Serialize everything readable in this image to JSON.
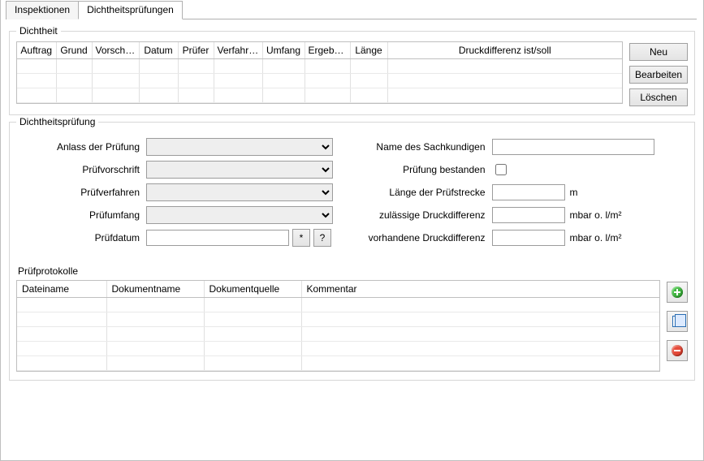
{
  "tabs": {
    "inspektionen": "Inspektionen",
    "dichtheit": "Dichtheitsprüfungen"
  },
  "dichtheit": {
    "legend": "Dichtheit",
    "columns": {
      "auftrag": "Auftrag",
      "grund": "Grund",
      "vorschrift": "Vorschrift",
      "datum": "Datum",
      "pruefer": "Prüfer",
      "verfahren": "Verfahren",
      "umfang": "Umfang",
      "ergebnis": "Ergebnis",
      "laenge": "Länge",
      "druckdiff": "Druckdifferenz ist/soll"
    },
    "buttons": {
      "neu": "Neu",
      "bearbeiten": "Bearbeiten",
      "loeschen": "Löschen"
    }
  },
  "pruefung": {
    "legend": "Dichtheitsprüfung",
    "labels": {
      "anlass": "Anlass der Prüfung",
      "vorschrift": "Prüfvorschrift",
      "verfahren": "Prüfverfahren",
      "umfang": "Prüfumfang",
      "datum": "Prüfdatum",
      "name": "Name des Sachkundigen",
      "bestanden": "Prüfung bestanden",
      "laenge": "Länge der Prüfstrecke",
      "zulaessig": "zulässige Druckdifferenz",
      "vorhanden": "vorhandene Druckdifferenz"
    },
    "units": {
      "m": "m",
      "mbar": "mbar o.  l/m²"
    },
    "datebar": {
      "star": "*",
      "help": "?"
    }
  },
  "protokolle": {
    "label": "Prüfprotokolle",
    "columns": {
      "dateiname": "Dateiname",
      "dokname": "Dokumentname",
      "dokquelle": "Dokumentquelle",
      "kommentar": "Kommentar"
    }
  }
}
